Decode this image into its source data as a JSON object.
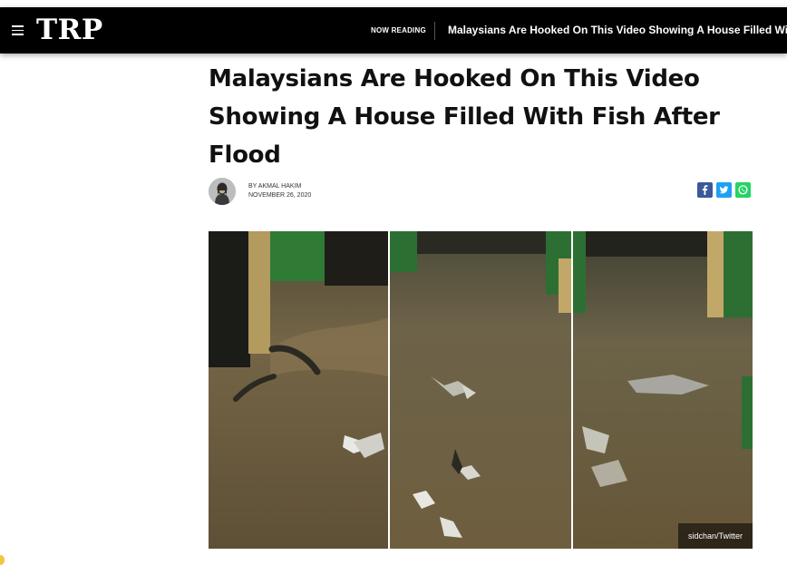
{
  "header": {
    "logo": "TRP",
    "now_reading_label": "NOW READING",
    "now_reading_title": "Malaysians Are Hooked On This Video Showing A House Filled With Fish"
  },
  "article": {
    "title": "Malaysians Are Hooked On This Video Showing A House Filled With Fish After Flood",
    "author": "BY AKMAL HAKIM",
    "date": "NOVEMBER 26, 2020"
  },
  "share": {
    "facebook_icon": "facebook-icon",
    "twitter_icon": "twitter-icon",
    "whatsapp_icon": "whatsapp-icon",
    "colors": {
      "facebook": "#3b5998",
      "twitter": "#1da1f2",
      "whatsapp": "#25d366"
    }
  },
  "media": {
    "credit": "sidchan/Twitter",
    "alt": "Flooded house with fish swimming in muddy water"
  }
}
